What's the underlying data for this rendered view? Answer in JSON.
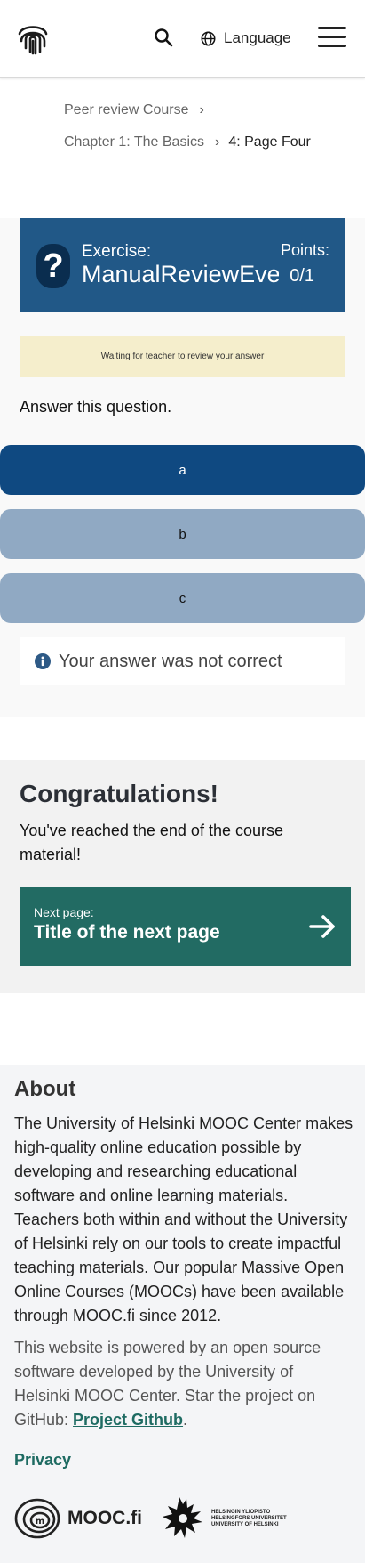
{
  "header": {
    "logo_icon": "fingerprint-icon",
    "search_icon": "search-icon",
    "language_label": "Language",
    "menu_icon": "hamburger-icon"
  },
  "breadcrumb": {
    "course": "Peer review Course",
    "chapter": "Chapter 1: The Basics",
    "page": "4: Page Four",
    "separator": "›"
  },
  "exercise": {
    "label": "Exercise:",
    "title": "ManualReviewEverything",
    "points_label": "Points:",
    "points_value": "0/1",
    "status": "Waiting for teacher to review your answer",
    "question": "Answer this question.",
    "options": [
      {
        "label": "a",
        "selected": true
      },
      {
        "label": "b",
        "selected": false
      },
      {
        "label": "c",
        "selected": false
      }
    ],
    "feedback": "Your answer was not correct"
  },
  "congrats": {
    "title": "Congratulations!",
    "text": "You've reached the end of the course material!",
    "next_label": "Next page:",
    "next_title": "Title of the next page"
  },
  "about": {
    "title": "About",
    "paragraph1": "The University of Helsinki MOOC Center makes high-quality online education possible by developing and researching educational software and online learning materials. Teachers both within and without the University of Helsinki rely on our tools to create impactful teaching materials. Our popular Massive Open Online Courses (MOOCs) have been available through MOOC.fi since 2012.",
    "paragraph2_prefix": "This website is powered by an open source software developed by the University of Helsinki MOOC Center. Star the project on GitHub: ",
    "github_link": "Project Github",
    "paragraph2_suffix": ".",
    "privacy": "Privacy",
    "mooc_logo_text": "MOOC.fi",
    "uh_lines": [
      "HELSINGIN YLIOPISTO",
      "HELSINGFORS UNIVERSITET",
      "UNIVERSITY OF HELSINKI"
    ]
  },
  "colors": {
    "exercise_header": "#215887",
    "selected_option": "#0f4981",
    "unselected_option": "#90a9c3",
    "status_bg": "#f5eecc",
    "next_button": "#226b63",
    "link": "#1e6b62"
  }
}
